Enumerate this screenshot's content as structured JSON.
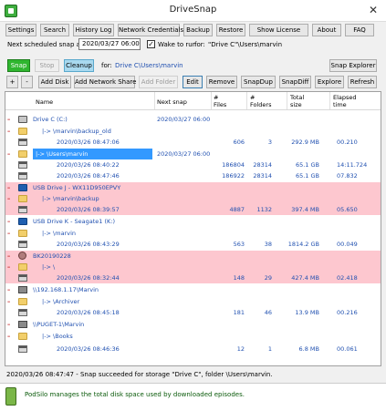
{
  "window": {
    "title": "DriveSnap"
  },
  "toolbar": {
    "settings": "Settings",
    "search": "Search",
    "history": "History Log",
    "credentials": "Network Credentials",
    "backup": "Backup",
    "restore": "Restore",
    "license": "Show License",
    "about": "About",
    "faq": "FAQ"
  },
  "schedule": {
    "label": "Next scheduled snap at:",
    "value": "2020/03/27 06:00",
    "wake_checked": "✓",
    "wake_label": "Wake to run",
    "for_label": "for:",
    "target": "\"Drive C\"\\Users\\marvin"
  },
  "actions": {
    "snap": "Snap",
    "stop": "Stop",
    "cleanup": "Cleanup",
    "for_label": "for:",
    "target": "Drive C\\Users\\marvin",
    "explorer": "Snap Explorer"
  },
  "row_buttons": {
    "plus": "+",
    "minus": "-",
    "add_disk": "Add Disk",
    "add_network": "Add Network Share",
    "add_folder": "Add Folder",
    "edit": "Edit",
    "remove": "Remove",
    "snapdup": "SnapDup",
    "snapdiff": "SnapDiff",
    "explore": "Explore",
    "refresh": "Refresh"
  },
  "columns": {
    "name": "Name",
    "next": "Next snap",
    "files_1": "#",
    "files_2": "Files",
    "folders_1": "#",
    "folders_2": "Folders",
    "size_1": "Total",
    "size_2": "size",
    "elapsed_1": "Elapsed",
    "elapsed_2": "time"
  },
  "rows": [
    {
      "name": "Drive C (C:)",
      "next": "2020/03/27 06:00"
    },
    {
      "name": "|-> \\marvin\\backup_old"
    },
    {
      "name": "2020/03/26 08:47:06",
      "files": "606",
      "folders": "3",
      "size": "292.9 MB",
      "elapsed": "00.210"
    },
    {
      "name": "|-> \\Users\\marvin",
      "next": "2020/03/27 06:00"
    },
    {
      "name": "2020/03/26 08:40:22",
      "files": "186804",
      "folders": "28314",
      "size": "65.1 GB",
      "elapsed": "14:11.724"
    },
    {
      "name": "2020/03/26 08:47:46",
      "files": "186922",
      "folders": "28314",
      "size": "65.1 GB",
      "elapsed": "07.832"
    },
    {
      "name": "USB Drive J - WX11D950EPVY"
    },
    {
      "name": "|-> \\marvin\\backup"
    },
    {
      "name": "2020/03/26 08:39:57",
      "files": "4887",
      "folders": "1132",
      "size": "397.4 MB",
      "elapsed": "05.650"
    },
    {
      "name": "USB Drive K - Seagate1 (K:)"
    },
    {
      "name": "|-> \\marvin"
    },
    {
      "name": "2020/03/26 08:43:29",
      "files": "563",
      "folders": "38",
      "size": "1814.2 GB",
      "elapsed": "00.049"
    },
    {
      "name": "BK20190228"
    },
    {
      "name": "|-> \\"
    },
    {
      "name": "2020/03/26 08:32:44",
      "files": "148",
      "folders": "29",
      "size": "427.4 MB",
      "elapsed": "02.418"
    },
    {
      "name": "\\\\192.168.1.17\\Marvin"
    },
    {
      "name": "|-> \\Archiver"
    },
    {
      "name": "2020/03/26 08:45:18",
      "files": "181",
      "folders": "46",
      "size": "13.9 MB",
      "elapsed": "00.216"
    },
    {
      "name": "\\\\PUGET-1\\Marvin"
    },
    {
      "name": "|-> \\Books"
    },
    {
      "name": "2020/03/26 08:46:36",
      "files": "12",
      "folders": "1",
      "size": "6.8 MB",
      "elapsed": "00.061"
    }
  ],
  "status": {
    "text": "2020/03/26 08:47:47 - Snap succeeded for storage \"Drive C\", folder \\Users\\marvin."
  },
  "footer": {
    "ad": "PodSilo manages the total disk space used by downloaded episodes."
  },
  "colors": {
    "snap_button": "#2fb62f",
    "cleanup_button": "#a9d9ef",
    "pink_row": "#fdc7cf",
    "selection": "#3399ff",
    "link_blue": "#2050b0"
  },
  "icons": {
    "root_drive": "drive-icon",
    "usb": "usb-drive-icon",
    "disc": "disc-icon",
    "network": "network-share-icon",
    "folder": "folder-icon",
    "snapshot": "calendar-icon"
  }
}
